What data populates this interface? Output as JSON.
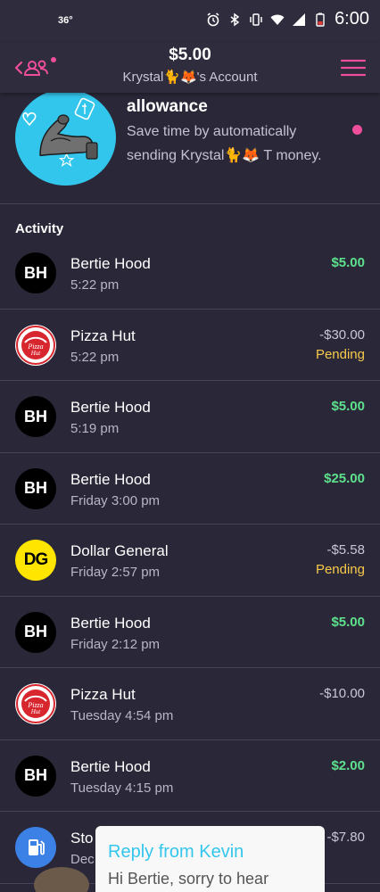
{
  "status_bar": {
    "temperature": "36°",
    "time": "6:00"
  },
  "header": {
    "amount": "$5.00",
    "account": "Krystal🐈🦊's Account"
  },
  "allowance": {
    "title": "allowance",
    "description": "Save time by automatically sending Krystal🐈🦊 T money."
  },
  "activity": {
    "title": "Activity",
    "items": [
      {
        "name": "Bertie Hood",
        "time": "5:22 pm",
        "amount": "$5.00",
        "status": "",
        "avatar": "BH",
        "type": "credit"
      },
      {
        "name": "Pizza Hut",
        "time": "5:22 pm",
        "amount": "-$30.00",
        "status": "Pending",
        "avatar": "pizza-hut-logo",
        "type": "debit"
      },
      {
        "name": "Bertie Hood",
        "time": "5:19 pm",
        "amount": "$5.00",
        "status": "",
        "avatar": "BH",
        "type": "credit"
      },
      {
        "name": "Bertie Hood",
        "time": "Friday 3:00 pm",
        "amount": "$25.00",
        "status": "",
        "avatar": "BH",
        "type": "credit"
      },
      {
        "name": "Dollar General",
        "time": "Friday 2:57 pm",
        "amount": "-$5.58",
        "status": "Pending",
        "avatar": "DG",
        "type": "debit"
      },
      {
        "name": "Bertie Hood",
        "time": "Friday 2:12 pm",
        "amount": "$5.00",
        "status": "",
        "avatar": "BH",
        "type": "credit"
      },
      {
        "name": "Pizza Hut",
        "time": "Tuesday 4:54 pm",
        "amount": "-$10.00",
        "status": "",
        "avatar": "pizza-hut-logo",
        "type": "debit"
      },
      {
        "name": "Bertie Hood",
        "time": "Tuesday 4:15 pm",
        "amount": "$2.00",
        "status": "",
        "avatar": "BH",
        "type": "credit"
      },
      {
        "name": "Sto",
        "time": "Dec",
        "amount": "-$7.80",
        "status": "",
        "avatar": "gas-pump-icon",
        "type": "debit"
      }
    ]
  },
  "notification": {
    "title": "Reply from Kevin",
    "body": "Hi Bertie, sorry to hear"
  },
  "colors": {
    "background": "#2a2838",
    "accent_pink": "#ef4e9b",
    "credit_green": "#5ee08c",
    "pending_yellow": "#f7c94a",
    "allowance_blue": "#33c6ec"
  }
}
